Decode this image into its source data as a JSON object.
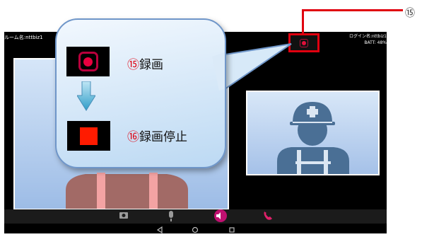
{
  "room_label": "ルーム名:nttbiz1",
  "login_label": "ログイン名:nttbiz1",
  "battery_label": "BATT: 48%",
  "callout_number": "⑮",
  "bubble": {
    "record": {
      "number": "⑮",
      "text": "録画"
    },
    "stop": {
      "number": "⑯",
      "text": "録画停止"
    }
  },
  "icons": [
    "record-icon",
    "arrow-down-icon",
    "stop-icon",
    "camera-icon",
    "microphone-icon",
    "speaker-icon",
    "phone-icon",
    "back-icon",
    "home-icon",
    "recent-apps-icon"
  ],
  "colors": {
    "highlight": "#e0000f",
    "record": "#e8003f",
    "stop": "#ff1b00",
    "bubble_border": "#6f96c9"
  }
}
